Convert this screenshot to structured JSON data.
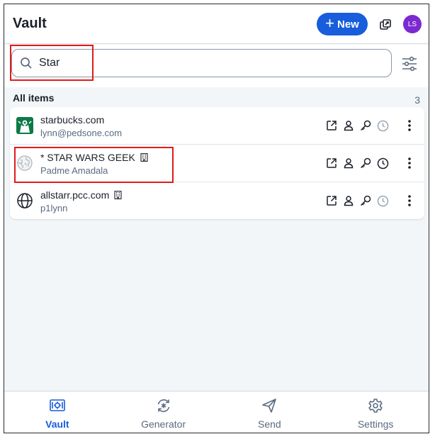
{
  "header": {
    "title": "Vault",
    "new_button_label": "New",
    "avatar_initials": "LS",
    "brand_color": "#175ddc",
    "avatar_color": "#7b2ad1"
  },
  "search": {
    "value": "Star",
    "icon": "search-icon",
    "filter_icon": "sliders-icon"
  },
  "section": {
    "title": "All items",
    "count": "3"
  },
  "items": [
    {
      "name": "starbucks.com",
      "subtitle": "lynn@pedsone.com",
      "icon": "starbucks-favicon",
      "org": false
    },
    {
      "name": "* STAR WARS GEEK",
      "subtitle": "Padme Amadala",
      "icon": "globe-favicon",
      "org": true
    },
    {
      "name": "allstarr.pcc.com",
      "subtitle": "p1lynn",
      "icon": "globe-icon",
      "org": true
    }
  ],
  "item_actions": [
    "launch-icon",
    "user-icon",
    "key-icon",
    "clock-icon",
    "more-vertical-icon"
  ],
  "nav": {
    "vault": "Vault",
    "generator": "Generator",
    "send": "Send",
    "settings": "Settings"
  }
}
